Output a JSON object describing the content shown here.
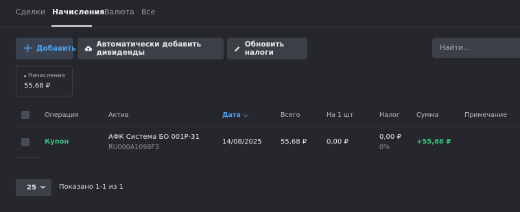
{
  "tabs": [
    "Сделки",
    "Начисления",
    "Валюта",
    "Все"
  ],
  "active_tab": "Начисления",
  "toolbar": {
    "add_label": "Добавить",
    "auto_dividends_label": "Автоматически добавить дивиденды",
    "update_taxes_label": "Обновить налоги",
    "search_placeholder": "Найти..."
  },
  "summary": {
    "label": "Начисления",
    "value": "55,68 ₽"
  },
  "table": {
    "columns": {
      "operation": "Операция",
      "asset": "Актив",
      "date": "Дата",
      "total": "Всего",
      "per_unit": "На 1 шт",
      "tax": "Налог",
      "sum": "Сумма",
      "note": "Примечание"
    },
    "sorted_by": "date",
    "rows": [
      {
        "operation": "Купон",
        "asset_name": "АФК Система БО 001Р-31",
        "asset_isin": "RU000A1098F3",
        "date": "14/08/2025",
        "total": "55,68 ₽",
        "per_unit": "0,00 ₽",
        "tax": "0,00 ₽",
        "tax_pct": "0%",
        "sum": "+55,68 ₽",
        "note": ""
      }
    ]
  },
  "footer": {
    "page_size": "25",
    "shown_text": "Показано 1-1 из 1"
  },
  "colors": {
    "background": "#26272c",
    "accent": "#4ba3f2",
    "positive": "#37c07b"
  }
}
